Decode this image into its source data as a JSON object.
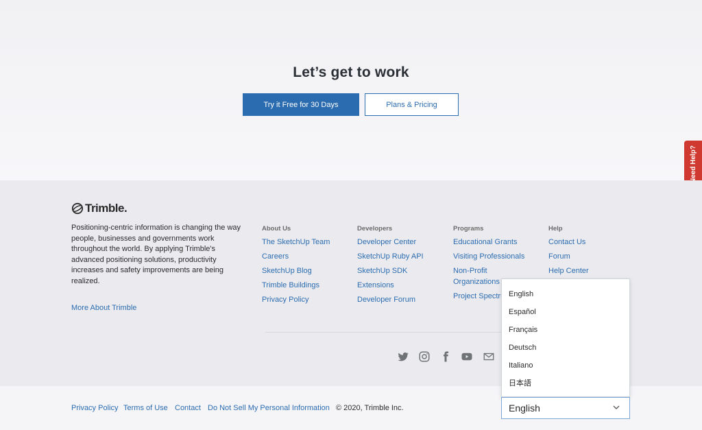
{
  "cta": {
    "title": "Let’s get to work",
    "primary_button": "Try it Free for 30 Days",
    "secondary_button": "Plans & Pricing"
  },
  "need_help": "Need Help?",
  "footer": {
    "logo_text": "Trimble.",
    "about": "Positioning-centric information is changing the way people, businesses and governments work throughout the world. By applying Trimble's advanced positioning solutions, productivity increases and safety improvements are being realized.",
    "more_about": "More About Trimble",
    "columns": [
      {
        "heading": "About Us",
        "links": [
          "The SketchUp Team",
          "Careers",
          "SketchUp Blog",
          "Trimble Buildings",
          "Privacy Policy"
        ]
      },
      {
        "heading": "Developers",
        "links": [
          "Developer Center",
          "SketchUp Ruby API",
          "SketchUp SDK",
          "Extensions",
          "Developer Forum"
        ]
      },
      {
        "heading": "Programs",
        "links": [
          "Educational Grants",
          "Visiting Professionals",
          "Non-Profit Organizations",
          "Project Spectrum"
        ]
      },
      {
        "heading": "Help",
        "links": [
          "Contact Us",
          "Forum",
          "Help Center"
        ]
      }
    ],
    "social_icons": [
      "twitter-icon",
      "instagram-icon",
      "facebook-icon",
      "youtube-icon",
      "email-icon"
    ]
  },
  "bottom": {
    "links": [
      "Privacy Policy",
      "Terms of Use",
      "Contact",
      "Do Not Sell My Personal Information"
    ],
    "copyright": "© 2020, Trimble Inc."
  },
  "language": {
    "selected": "English",
    "options": [
      "English",
      "Español",
      "Français",
      "Deutsch",
      "Italiano",
      "日本語"
    ]
  },
  "colors": {
    "accent": "#2b6cb0",
    "help_tab": "#d0392f"
  }
}
